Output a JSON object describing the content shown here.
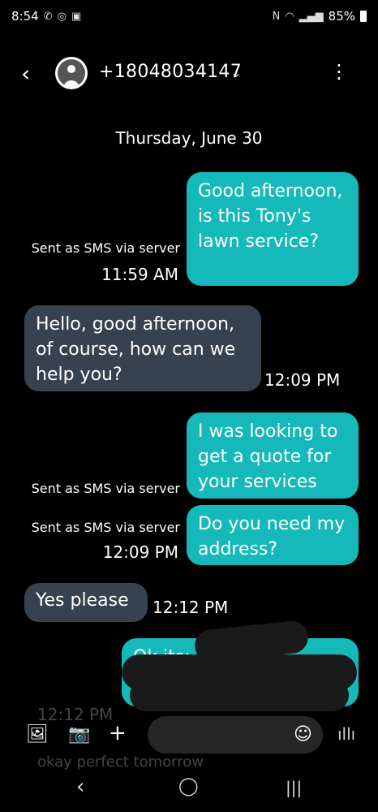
{
  "status_bar": {
    "time": "8:54",
    "battery": "85%"
  },
  "header": {
    "back_icon": "back-arrow-icon",
    "contact": "+18048034147",
    "more_icon": "more-vertical-icon"
  },
  "date_separator": "Thursday, June 30",
  "messages": [
    {
      "direction": "out",
      "text": "Good afternoon, is this Tony's lawn service?",
      "meta": "Sent as SMS via server",
      "time": "11:59 AM"
    },
    {
      "direction": "in",
      "text": "Hello, good afternoon, of course, how can we help you?",
      "time": "12:09 PM"
    },
    {
      "direction": "out",
      "text": "I was looking to get a quote for your services",
      "meta": "Sent as SMS via server"
    },
    {
      "direction": "out",
      "text": "Do you need my address?",
      "meta": "Sent as SMS via server",
      "time": "12:09 PM"
    },
    {
      "direction": "in",
      "text": "Yes please",
      "time": "12:12 PM"
    },
    {
      "direction": "out",
      "text": "Ok its:"
    }
  ],
  "ghost_time": "12:12 PM",
  "ghost_message": "okay perfect tomorrow",
  "colors": {
    "outgoing": "#16b9b9",
    "incoming": "#374250",
    "background": "#000000"
  }
}
